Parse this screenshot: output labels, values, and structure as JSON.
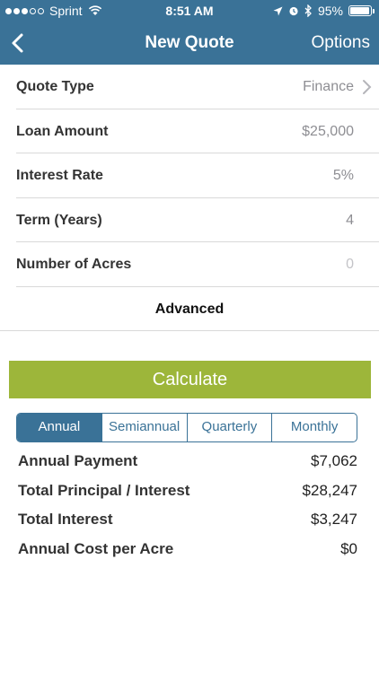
{
  "status_bar": {
    "carrier": "Sprint",
    "time": "8:51 AM",
    "battery_percent": "95%",
    "battery_level": 0.95,
    "signal_dots_filled": 3,
    "signal_dots_total": 5
  },
  "nav": {
    "title": "New Quote",
    "options_label": "Options",
    "back_icon": "chevron-left-icon"
  },
  "form": {
    "quote_type": {
      "label": "Quote Type",
      "value": "Finance"
    },
    "loan_amount": {
      "label": "Loan Amount",
      "value": "$25,000"
    },
    "interest_rate": {
      "label": "Interest Rate",
      "value": "5%"
    },
    "term_years": {
      "label": "Term (Years)",
      "value": "4"
    },
    "acres": {
      "label": "Number of Acres",
      "placeholder": "0"
    },
    "advanced_label": "Advanced"
  },
  "calculate_label": "Calculate",
  "frequency": {
    "options": [
      "Annual",
      "Semiannual",
      "Quarterly",
      "Monthly"
    ],
    "selected": "Annual"
  },
  "results": [
    {
      "label": "Annual Payment",
      "value": "$7,062"
    },
    {
      "label": "Total Principal / Interest",
      "value": "$28,247"
    },
    {
      "label": "Total Interest",
      "value": "$3,247"
    },
    {
      "label": "Annual Cost per Acre",
      "value": "$0"
    }
  ],
  "colors": {
    "header": "#3a7297",
    "calculate_button": "#9db63a",
    "segment_accent": "#3a7297"
  }
}
